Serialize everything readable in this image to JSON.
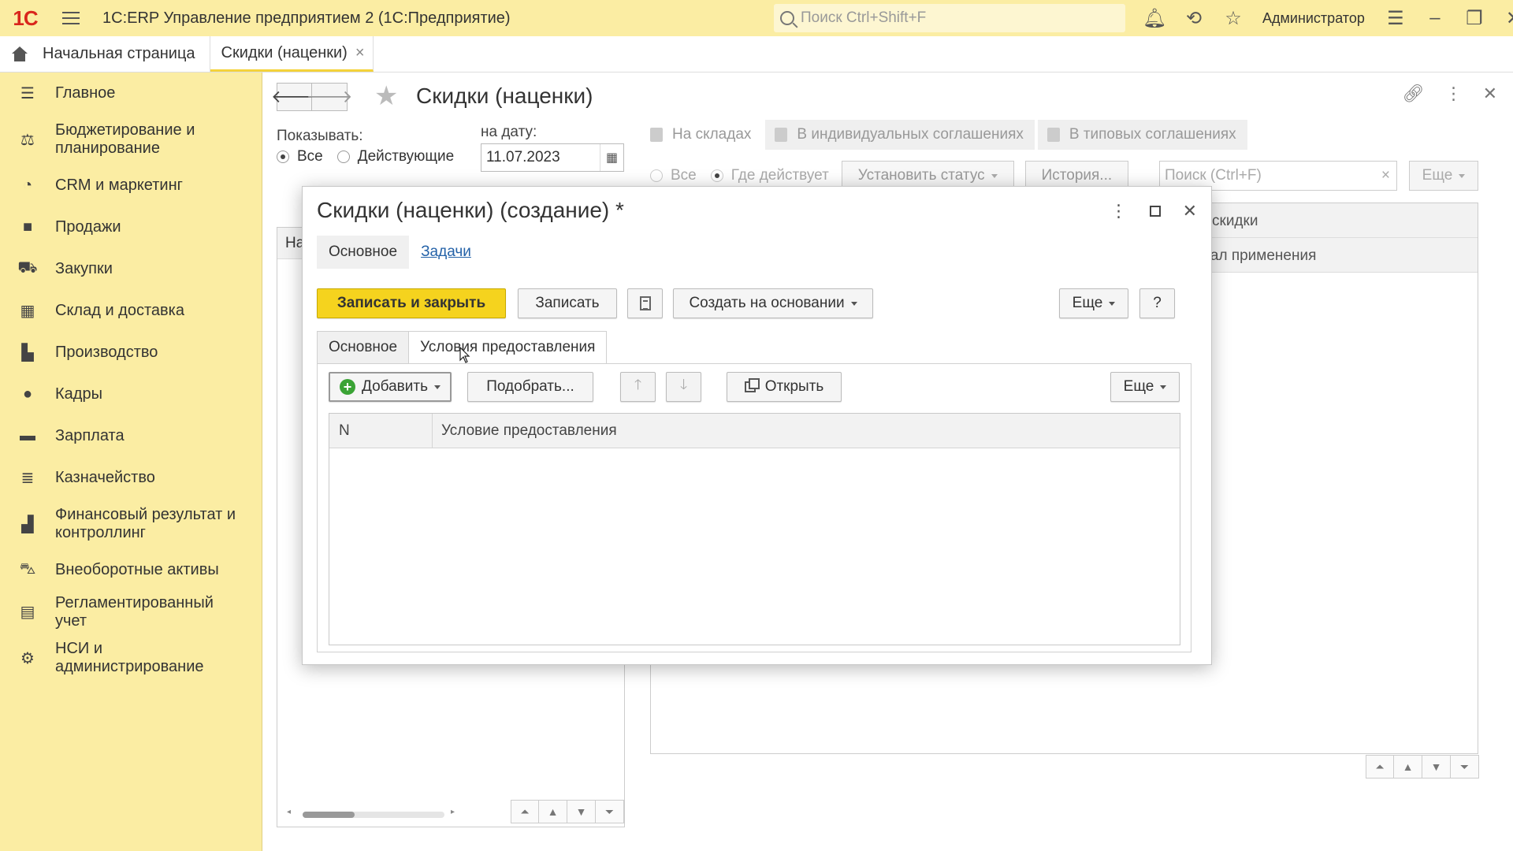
{
  "app": {
    "logo_text": "1С",
    "title": "1С:ERP Управление предприятием 2  (1С:Предприятие)",
    "search_placeholder": "Поиск Ctrl+Shift+F",
    "user": "Администратор"
  },
  "tabs": {
    "home": "Начальная страница",
    "open": "Скидки (наценки)",
    "close_glyph": "×"
  },
  "sidebar": {
    "items": [
      {
        "label": "Главное",
        "icon": "menu-lines-icon"
      },
      {
        "label": "Бюджетирование и планирование",
        "icon": "budget-icon"
      },
      {
        "label": "CRM и маркетинг",
        "icon": "pie-chart-icon"
      },
      {
        "label": "Продажи",
        "icon": "shopping-bag-icon"
      },
      {
        "label": "Закупки",
        "icon": "cart-icon"
      },
      {
        "label": "Склад и доставка",
        "icon": "warehouse-grid-icon"
      },
      {
        "label": "Производство",
        "icon": "factory-icon"
      },
      {
        "label": "Кадры",
        "icon": "person-icon"
      },
      {
        "label": "Зарплата",
        "icon": "wallet-icon"
      },
      {
        "label": "Казначейство",
        "icon": "coins-icon"
      },
      {
        "label": "Финансовый результат и контроллинг",
        "icon": "bar-chart-icon"
      },
      {
        "label": "Внеоборотные активы",
        "icon": "truck-icon"
      },
      {
        "label": "Регламентированный учет",
        "icon": "calculator-icon"
      },
      {
        "label": "НСИ и администрирование",
        "icon": "gear-icon"
      }
    ]
  },
  "main": {
    "title": "Скидки (наценки)",
    "show_label": "Показывать:",
    "radio_all": "Все",
    "radio_active": "Действующие",
    "date_label": "на дату:",
    "date_value": "11.07.2023",
    "left_header": "На",
    "right_tabs": [
      "На складах",
      "В индивидуальных соглашениях",
      "В типовых соглашениях"
    ],
    "right_radio_all": "Все",
    "right_radio_where": "Где действует",
    "set_status": "Установить статус",
    "history": "История...",
    "search_placeholder": "Поиск (Ctrl+F)",
    "more": "Еще",
    "col1_partial": "скидки",
    "col2_partial": "вал применения"
  },
  "dialog": {
    "title": "Скидки (наценки) (создание) *",
    "tabs": [
      "Основное",
      "Задачи"
    ],
    "save_close": "Записать и закрыть",
    "save": "Записать",
    "create_based": "Создать на основании",
    "more": "Еще",
    "help": "?",
    "inner_tabs": [
      "Основное",
      "Условия предоставления"
    ],
    "add": "Добавить",
    "pick": "Подобрать...",
    "open": "Открыть",
    "col_n": "N",
    "col_condition": "Условие предоставления"
  }
}
